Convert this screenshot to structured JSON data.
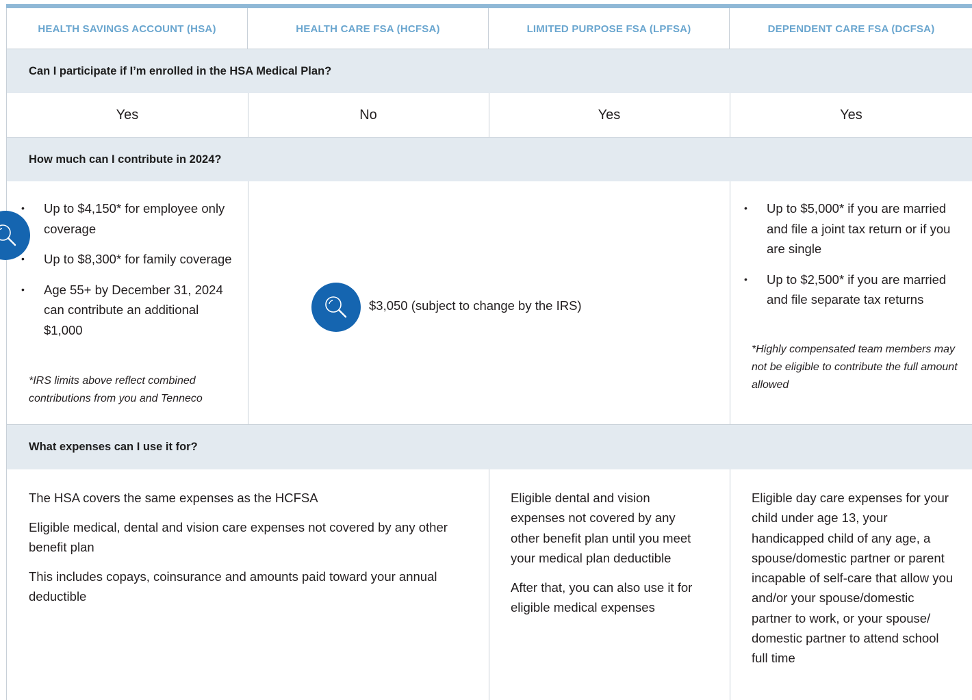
{
  "columns": [
    "HEALTH SAVINGS ACCOUNT (HSA)",
    "HEALTH CARE FSA (HCFSA)",
    "LIMITED PURPOSE FSA (LPFSA)",
    "DEPENDENT CARE FSA (DCFSA)"
  ],
  "rows": {
    "participate": {
      "question": "Can I participate if I’m enrolled in the HSA Medical Plan?",
      "answers": [
        "Yes",
        "No",
        "Yes",
        "Yes"
      ]
    },
    "contribute": {
      "question": "How much can I contribute in 2024?",
      "hsa": {
        "bullets": [
          "Up to $4,150* for employee only coverage",
          "Up to $8,300* for family coverage",
          "Age 55+ by December 31, 2024 can contribute an additional $1,000"
        ],
        "note": "*IRS limits above reflect combined contributions from you and Tenneco"
      },
      "fsa_amount": "$3,050 (subject to change by the IRS)",
      "dcfsa": {
        "bullets": [
          "Up to $5,000* if you are married and file a joint tax return or if you are single",
          "Up to $2,500* if you are married and file separate tax returns"
        ],
        "note": "*Highly compensated team members may not be eligible to contribute the full amount allowed"
      }
    },
    "expenses": {
      "question": "What expenses can I use it for?",
      "hsa_hcfsa": [
        "The HSA covers the same expenses as the HCFSA",
        "Eligible medical, dental and vision care expenses not covered by any other benefit plan",
        "This includes copays, coinsurance and amounts paid toward your annual deductible"
      ],
      "lpfsa": [
        "Eligible dental and vision expenses not covered by any other benefit plan until you meet your medical plan deductible",
        "After that, you can also use it for eligible medical expenses"
      ],
      "dcfsa": [
        "Eligible day care expenses for your child under age 13, your handicapped child of any age, a spouse/domestic partner or parent incapable of self-care that allow you and/or your spouse/domestic partner to work, or your spouse/ domestic partner to attend school full time"
      ]
    }
  },
  "icons": [
    "magnifier-icon",
    "magnifier-icon"
  ],
  "colors": {
    "header_text": "#6aa6cf",
    "row_band": "#e3eaf0",
    "icon_bg": "#1565b0",
    "top_rule": "#8fb8d6"
  }
}
